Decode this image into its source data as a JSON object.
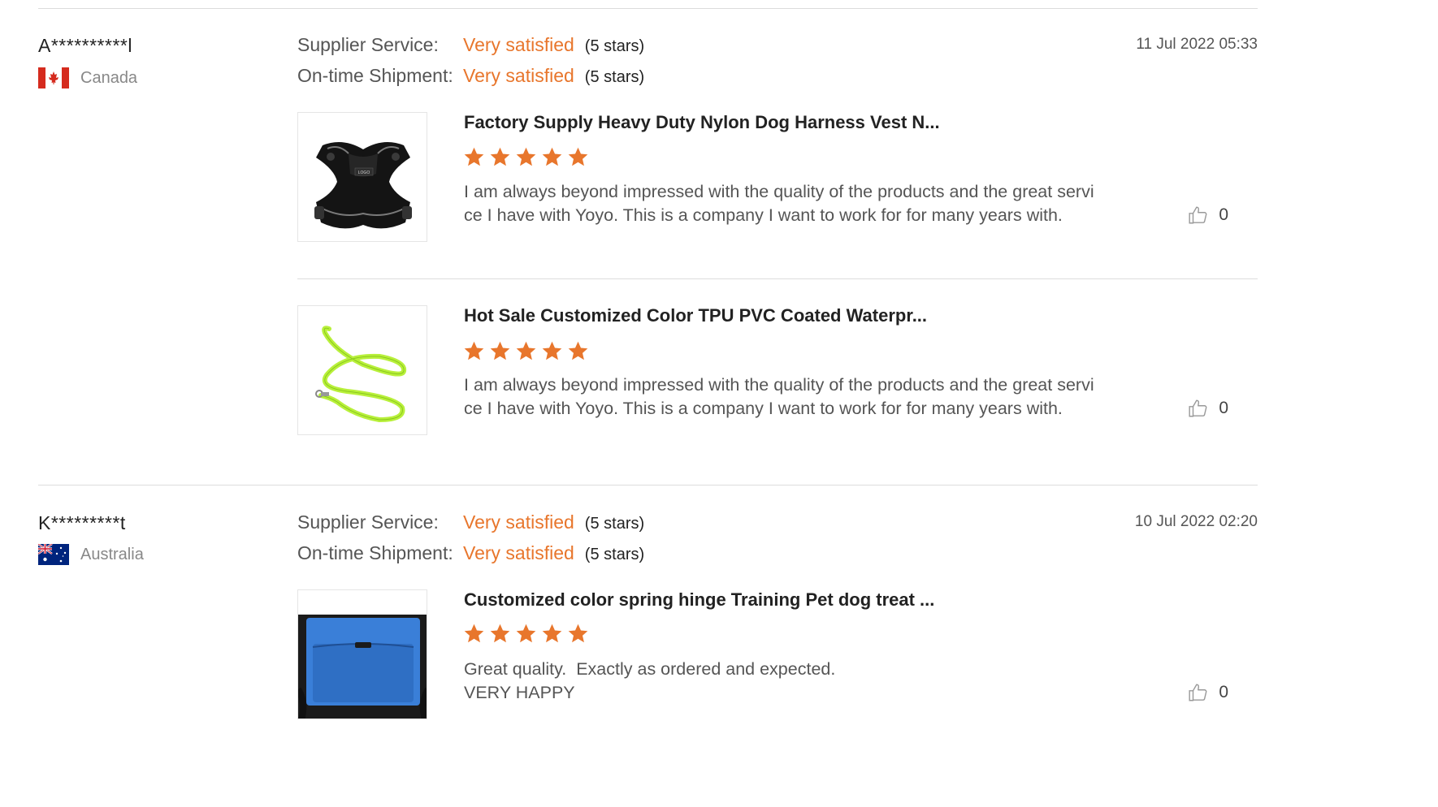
{
  "reviews": [
    {
      "buyer": "A**********l",
      "country": "Canada",
      "flag": "canada-flag-icon",
      "date": "11 Jul 2022 05:33",
      "supplier_service_label": "Supplier Service:",
      "supplier_service_value": "Very satisfied",
      "supplier_service_stars": "(5 stars)",
      "shipment_label": "On-time Shipment:",
      "shipment_value": "Very satisfied",
      "shipment_stars": "(5 stars)",
      "products": [
        {
          "title": "Factory Supply Heavy Duty Nylon Dog Harness Vest N...",
          "rating": 5,
          "comment_line1": "I am always beyond impressed with the quality of the products and the great servi",
          "comment_line2": "ce I have with Yoyo. This is a company I want to work for for many years with.",
          "likes": "0",
          "thumb_logo_text": "LOGO"
        },
        {
          "title": "Hot Sale Customized Color TPU PVC Coated Waterpr...",
          "rating": 5,
          "comment_line1": "I am always beyond impressed with the quality of the products and the great servi",
          "comment_line2": "ce I have with Yoyo. This is a company I want to work for for many years with.",
          "likes": "0"
        }
      ]
    },
    {
      "buyer": "K*********t",
      "country": "Australia",
      "flag": "australia-flag-icon",
      "date": "10 Jul 2022 02:20",
      "supplier_service_label": "Supplier Service:",
      "supplier_service_value": "Very satisfied",
      "supplier_service_stars": "(5 stars)",
      "shipment_label": "On-time Shipment:",
      "shipment_value": "Very satisfied",
      "shipment_stars": "(5 stars)",
      "products": [
        {
          "title": "Customized color spring hinge Training Pet dog treat ...",
          "rating": 5,
          "comment_line1": "Great quality.  Exactly as ordered and expected.",
          "comment_line2": "VERY HAPPY",
          "likes": "0"
        }
      ]
    }
  ],
  "colors": {
    "accent": "#e8762c",
    "star": "#e8762c",
    "divider": "#dcdcdc"
  }
}
